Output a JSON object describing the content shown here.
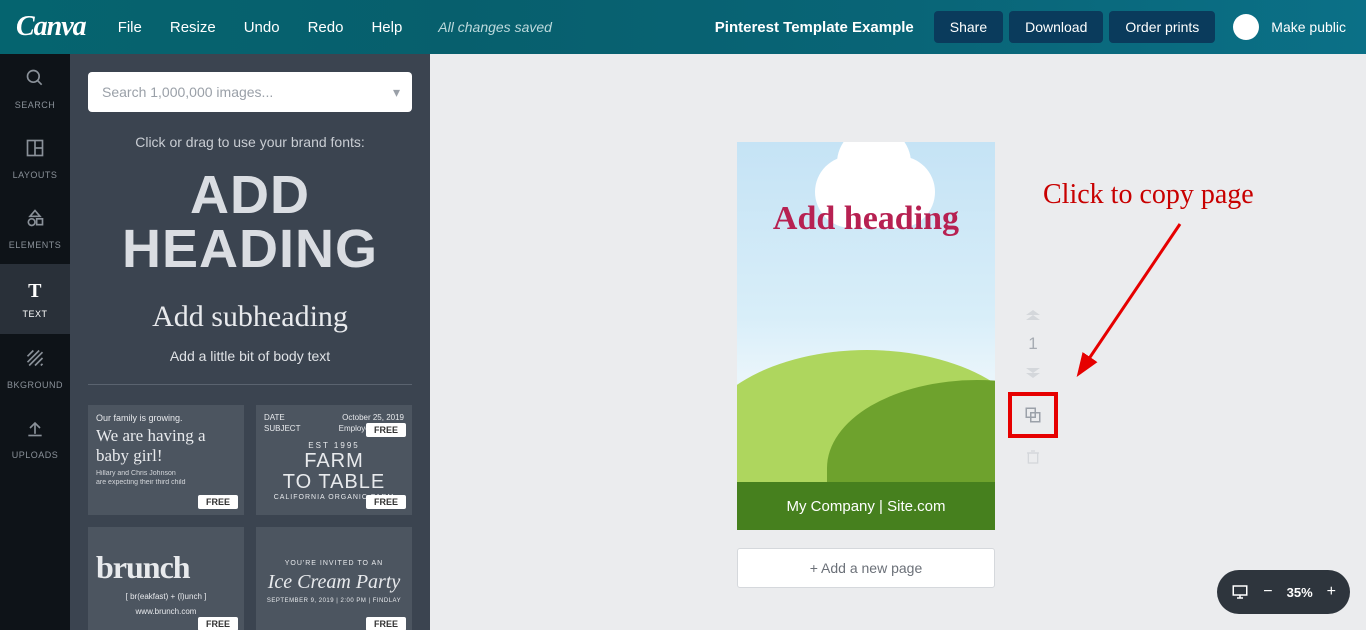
{
  "topbar": {
    "logo": "Canva",
    "menu": [
      "File",
      "Resize",
      "Undo",
      "Redo",
      "Help"
    ],
    "saved": "All changes saved",
    "docTitle": "Pinterest Template Example",
    "share": "Share",
    "download": "Download",
    "orderPrints": "Order prints",
    "makePublic": "Make public"
  },
  "sidenav": {
    "items": [
      {
        "label": "SEARCH"
      },
      {
        "label": "LAYOUTS"
      },
      {
        "label": "ELEMENTS"
      },
      {
        "label": "TEXT"
      },
      {
        "label": "BKGROUND"
      },
      {
        "label": "UPLOADS"
      }
    ]
  },
  "panel": {
    "searchPlaceholder": "Search 1,000,000 images...",
    "hint": "Click or drag to use your brand fonts:",
    "addHeading": "ADD HEADING",
    "addSub": "Add subheading",
    "addBody": "Add a little bit of body text",
    "freeBadge": "FREE",
    "tpl1": {
      "line1": "Our family is growing.",
      "big": "We are having a baby girl!",
      "small1": "Hillary and Chris Johnson",
      "small2": "are expecting their third child"
    },
    "tpl2": {
      "dateLabel": "DATE",
      "dateVal": "October 25, 2019",
      "subjLabel": "SUBJECT",
      "subjVal": "Employee Opinion",
      "est": "EST 1995",
      "big1": "FARM",
      "big2": "TO TABLE",
      "tag": "CALIFORNIA ORGANIC FARM"
    },
    "tpl3": {
      "big": "brunch",
      "sub1": "[ br(eakfast) + (l)unch ]",
      "sub2": "www.brunch.com"
    },
    "tpl4": {
      "inv": "YOU'RE INVITED TO AN",
      "big": "Ice Cream Party",
      "when": "SEPTEMBER 9, 2019 | 2:00 PM | FINDLAY"
    }
  },
  "canvas": {
    "pageHeading": "Add heading",
    "footer": "My Company | Site.com",
    "pageNumber": "1",
    "addPage": "+ Add a new page"
  },
  "annotation": "Click to copy page",
  "zoom": {
    "value": "35%"
  }
}
